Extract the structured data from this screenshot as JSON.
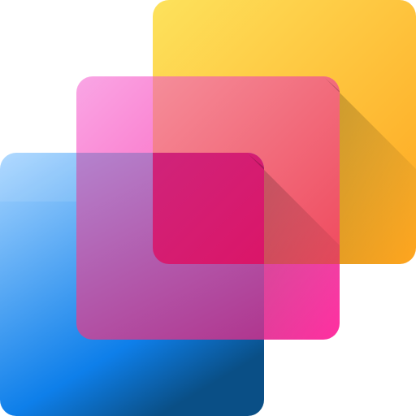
{
  "icon": {
    "name": "layered-squares-icon",
    "layers": [
      {
        "name": "back-square-yellow",
        "colors": {
          "top_left": "#FDE25C",
          "bottom_right": "#FFA51E"
        }
      },
      {
        "name": "middle-square-pink",
        "colors": {
          "top_left": "#F9A6E5",
          "bottom_right": "#FF2FA0"
        }
      },
      {
        "name": "front-square-blue",
        "colors": {
          "top_left": "#A9D6FF",
          "bottom_right": "#0E7FEA",
          "bottom_shade": "#0A4F86"
        }
      }
    ],
    "overlap_colors": {
      "yellow_pink": "#F0554E",
      "pink_blue": "#B0479E",
      "all_three": "#E30B5C"
    }
  }
}
